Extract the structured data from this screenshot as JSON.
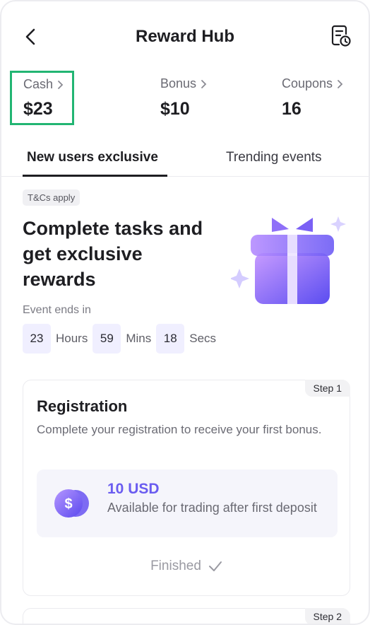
{
  "header": {
    "title": "Reward Hub"
  },
  "balances": {
    "cash": {
      "label": "Cash",
      "value": "$23"
    },
    "bonus": {
      "label": "Bonus",
      "value": "$10"
    },
    "coupons": {
      "label": "Coupons",
      "value": "16"
    }
  },
  "tabs": [
    {
      "label": "New users exclusive",
      "active": true
    },
    {
      "label": "Trending events",
      "active": false
    }
  ],
  "promo": {
    "badge": "T&Cs apply",
    "headline": "Complete tasks and get exclusive rewards",
    "event_ends_label": "Event ends in",
    "countdown": {
      "hours": "23",
      "hours_label": "Hours",
      "mins": "59",
      "mins_label": "Mins",
      "secs": "18",
      "secs_label": "Secs"
    }
  },
  "steps": [
    {
      "badge": "Step 1",
      "title": "Registration",
      "description": "Complete your registration to receive your first bonus.",
      "reward_amount": "10 USD",
      "reward_note": "Available for trading after first deposit",
      "status": "Finished"
    },
    {
      "badge": "Step 2"
    }
  ],
  "colors": {
    "accent": "#6a5cf0",
    "highlight_border": "#22b573",
    "reward_bg": "#f5f5fb"
  }
}
